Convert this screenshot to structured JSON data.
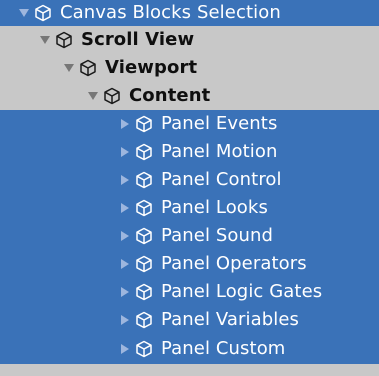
{
  "colors": {
    "selection": "#3a72b8",
    "background": "#c8c8c8",
    "selected_text": "#ffffff",
    "plain_text": "#0f0f0f",
    "arrow_selected": "#9db6de",
    "arrow_plain": "#777777"
  },
  "hierarchy": {
    "root": {
      "label": "Canvas Blocks Selection",
      "arrow_icon": "triangle-down-icon",
      "object_icon": "cube-icon"
    },
    "scroll_view": {
      "label": "Scroll View",
      "arrow_icon": "triangle-down-icon",
      "object_icon": "cube-icon"
    },
    "viewport": {
      "label": "Viewport",
      "arrow_icon": "triangle-down-icon",
      "object_icon": "cube-icon"
    },
    "content": {
      "label": "Content",
      "arrow_icon": "triangle-down-icon",
      "object_icon": "cube-icon"
    },
    "panels": [
      {
        "label": "Panel Events"
      },
      {
        "label": "Panel Motion"
      },
      {
        "label": "Panel Control"
      },
      {
        "label": "Panel Looks"
      },
      {
        "label": "Panel Sound"
      },
      {
        "label": "Panel Operators"
      },
      {
        "label": "Panel Logic Gates"
      },
      {
        "label": "Panel Variables"
      },
      {
        "label": "Panel Custom"
      }
    ]
  }
}
